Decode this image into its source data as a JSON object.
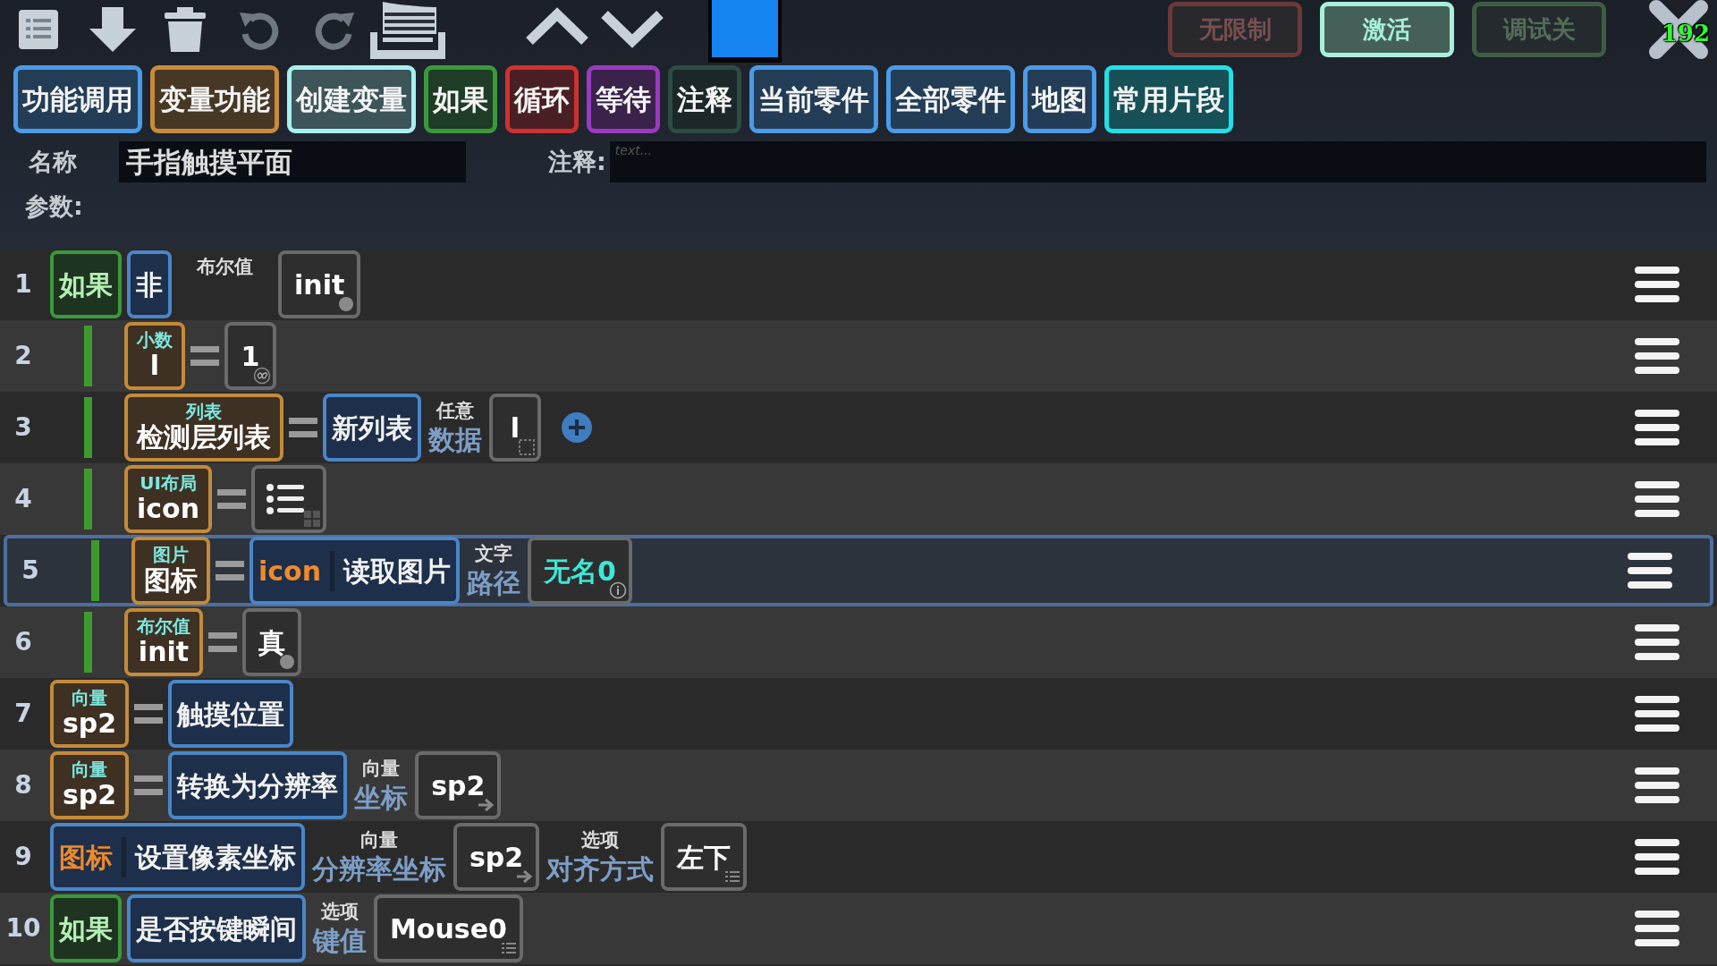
{
  "toolbar": {
    "close_overlay": "192"
  },
  "modes": [
    {
      "label": "无限制",
      "color": "#6a3a38",
      "on": false
    },
    {
      "label": "激活",
      "color": "#a8f0dc",
      "on": true
    },
    {
      "label": "调试关",
      "color": "#3e5e44",
      "on": false
    }
  ],
  "categories": [
    {
      "label": "功能调用",
      "color": "#4a9be8"
    },
    {
      "label": "变量功能",
      "color": "#c98a3a"
    },
    {
      "label": "创建变量",
      "color": "#a8f0f0"
    },
    {
      "label": "如果",
      "color": "#3a9a3a"
    },
    {
      "label": "循环",
      "color": "#d03030"
    },
    {
      "label": "等待",
      "color": "#9a3ac0"
    },
    {
      "label": "注释",
      "color": "#2c4c42"
    },
    {
      "label": "当前零件",
      "color": "#4a9be8"
    },
    {
      "label": "全部零件",
      "color": "#4a9be8"
    },
    {
      "label": "地图",
      "color": "#4a9be8"
    },
    {
      "label": "常用片段",
      "color": "#20e0e8"
    }
  ],
  "header": {
    "name_label": "名称",
    "name_value": "手指触摸平面",
    "comment_label": "注释:",
    "comment_placeholder": "text...",
    "params_label": "参数:"
  },
  "lines": [
    {
      "number": "1",
      "selected": false,
      "blocks": [
        {
          "kind": "control",
          "text": "如果"
        },
        {
          "kind": "func",
          "text": "非"
        },
        {
          "kind": "param",
          "label": "布尔值"
        },
        {
          "kind": "value",
          "text": "init",
          "corner": {
            "kind": "dot"
          }
        }
      ],
      "children": [
        {
          "number": "2",
          "selected": false,
          "blocks": [
            {
              "kind": "var",
              "type": "小数",
              "text": "l"
            },
            {
              "kind": "eq"
            },
            {
              "kind": "value",
              "text": "1",
              "corner": {
                "kind": "infinity"
              }
            }
          ]
        },
        {
          "number": "3",
          "selected": false,
          "blocks": [
            {
              "kind": "var",
              "type": "列表",
              "text": "检测层列表"
            },
            {
              "kind": "eq"
            },
            {
              "kind": "func",
              "text": "新列表"
            },
            {
              "kind": "param",
              "label": "任意",
              "name": "数据"
            },
            {
              "kind": "value",
              "text": "l",
              "corner": {
                "kind": "slot"
              }
            },
            {
              "kind": "add"
            }
          ]
        },
        {
          "number": "4",
          "selected": false,
          "blocks": [
            {
              "kind": "var",
              "type": "UI布局",
              "text": "icon"
            },
            {
              "kind": "eq"
            },
            {
              "kind": "value",
              "corner": {
                "kind": "list"
              }
            }
          ]
        },
        {
          "number": "5",
          "selected": true,
          "blocks": [
            {
              "kind": "var",
              "type": "图片",
              "text": "图标"
            },
            {
              "kind": "eq"
            },
            {
              "kind": "func",
              "prefix": "icon",
              "text": "读取图片"
            },
            {
              "kind": "param",
              "label": "文字",
              "name": "路径"
            },
            {
              "kind": "value",
              "text": "无名0",
              "color": "#3ee8d8",
              "corner": {
                "kind": "info"
              }
            }
          ]
        },
        {
          "number": "6",
          "selected": false,
          "blocks": [
            {
              "kind": "var",
              "type": "布尔值",
              "text": "init"
            },
            {
              "kind": "eq"
            },
            {
              "kind": "value",
              "text": "真",
              "corner": {
                "kind": "dot"
              }
            }
          ]
        }
      ]
    },
    {
      "number": "7",
      "selected": false,
      "blocks": [
        {
          "kind": "var",
          "type": "向量",
          "text": "sp2"
        },
        {
          "kind": "eq"
        },
        {
          "kind": "func",
          "text": "触摸位置"
        }
      ]
    },
    {
      "number": "8",
      "selected": false,
      "blocks": [
        {
          "kind": "var",
          "type": "向量",
          "text": "sp2"
        },
        {
          "kind": "eq"
        },
        {
          "kind": "func",
          "text": "转换为分辨率"
        },
        {
          "kind": "param",
          "label": "向量",
          "name": "坐标"
        },
        {
          "kind": "value",
          "text": "sp2",
          "corner": {
            "kind": "arrow"
          }
        }
      ]
    },
    {
      "number": "9",
      "selected": false,
      "blocks": [
        {
          "kind": "func",
          "prefix": "图标",
          "text": "设置像素坐标"
        },
        {
          "kind": "param",
          "label": "向量",
          "name": "分辨率坐标"
        },
        {
          "kind": "value",
          "text": "sp2",
          "corner": {
            "kind": "arrow"
          }
        },
        {
          "kind": "param",
          "label": "选项",
          "name": "对齐方式"
        },
        {
          "kind": "value",
          "text": "左下",
          "corner": {
            "kind": "menu"
          }
        }
      ]
    },
    {
      "number": "10",
      "selected": false,
      "blocks": [
        {
          "kind": "control",
          "text": "如果"
        },
        {
          "kind": "func",
          "text": "是否按键瞬间"
        },
        {
          "kind": "param",
          "label": "选项",
          "name": "键值"
        },
        {
          "kind": "value",
          "text": "Mouse0",
          "corner": {
            "kind": "menu"
          }
        }
      ]
    }
  ]
}
